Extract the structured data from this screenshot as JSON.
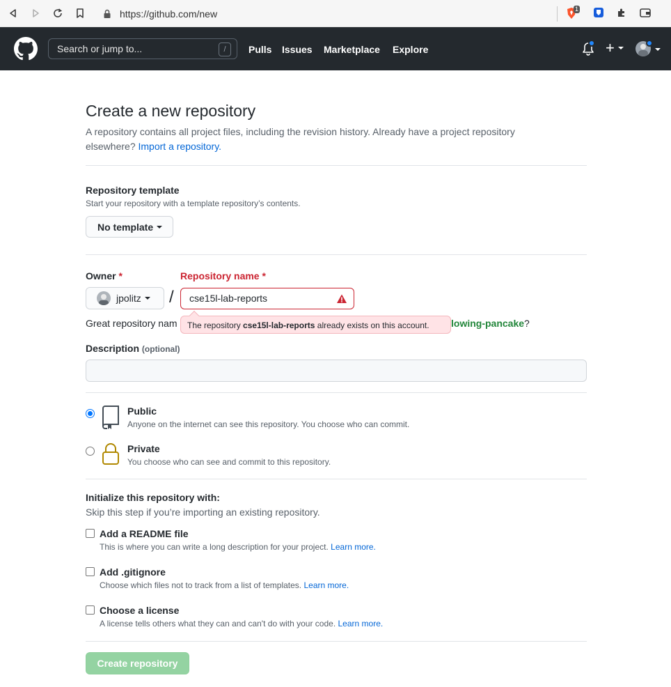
{
  "browser": {
    "url": "https://github.com/new",
    "brave_badge": "1"
  },
  "header": {
    "search_placeholder": "Search or jump to...",
    "search_key": "/",
    "nav": [
      "Pulls",
      "Issues",
      "Marketplace",
      "Explore"
    ],
    "plus_label": "+"
  },
  "page": {
    "title": "Create a new repository",
    "lead_text": "A repository contains all project files, including the revision history. Already have a project repository elsewhere?",
    "import_link": "Import a repository."
  },
  "template": {
    "label": "Repository template",
    "note": "Start your repository with a template repository’s contents.",
    "button": "No template"
  },
  "owner": {
    "label": "Owner",
    "required": "*",
    "value": "jpolitz",
    "slash": "/"
  },
  "repo_name": {
    "label": "Repository name",
    "required": "*",
    "value": "cse15l-lab-reports",
    "error_prefix": "The repository",
    "error_name": "cse15l-lab-reports",
    "error_suffix": "already exists on this account."
  },
  "suggestion": {
    "prefix": "Great repository nam",
    "name": "lowing-pancake",
    "suffix": "?"
  },
  "description": {
    "label": "Description",
    "optional": "(optional)",
    "value": ""
  },
  "visibility": {
    "public_title": "Public",
    "public_desc": "Anyone on the internet can see this repository. You choose who can commit.",
    "private_title": "Private",
    "private_desc": "You choose who can see and commit to this repository.",
    "selected": "public"
  },
  "init": {
    "title": "Initialize this repository with:",
    "note": "Skip this step if you’re importing an existing repository.",
    "options": [
      {
        "title": "Add a README file",
        "desc": "This is where you can write a long description for your project.",
        "link": "Learn more."
      },
      {
        "title": "Add .gitignore",
        "desc": "Choose which files not to track from a list of templates.",
        "link": "Learn more."
      },
      {
        "title": "Choose a license",
        "desc": "A license tells others what they can and can't do with your code.",
        "link": "Learn more."
      }
    ]
  },
  "submit": {
    "label": "Create repository"
  },
  "colors": {
    "header_bg": "#24292e",
    "error": "#cb2431",
    "link": "#0366d6",
    "success_disabled": "#94d3a2"
  }
}
